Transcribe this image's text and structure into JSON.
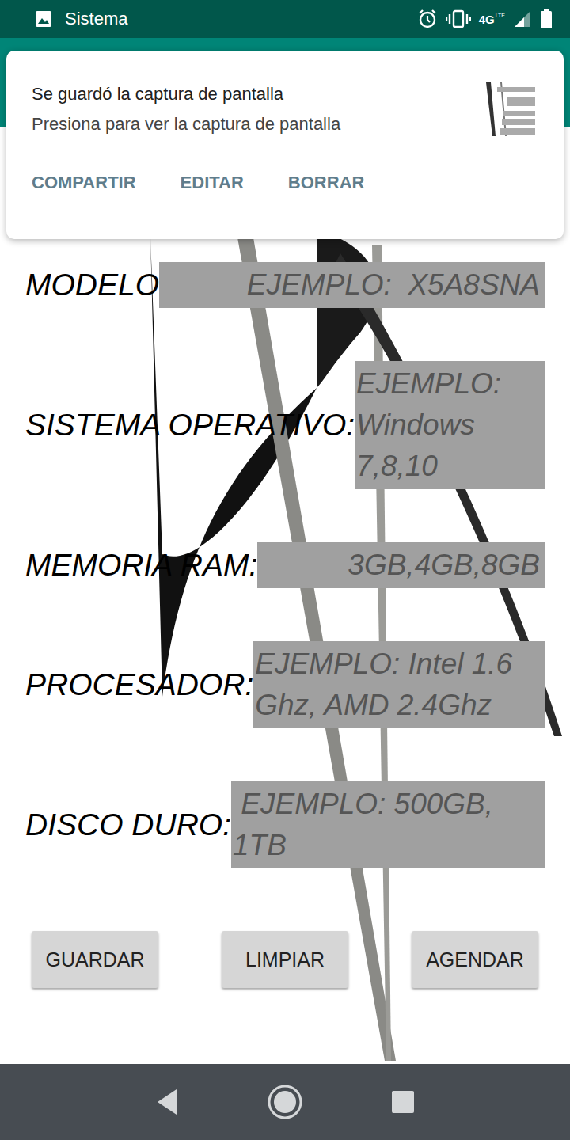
{
  "status_bar": {
    "title": "Sistema",
    "network": "4G",
    "network_badge": "LTE"
  },
  "notification": {
    "title": "Se guardó la captura de pantalla",
    "text": "Presiona para ver la captura de pantalla",
    "actions": [
      "COMPARTIR",
      "EDITAR",
      "BORRAR"
    ]
  },
  "form": {
    "fields": [
      {
        "label": "MODELO",
        "placeholder": "EJEMPLO:  X5A8SNA"
      },
      {
        "label": "SISTEMA OPERATIVO:",
        "placeholder": "EJEMPLO: Windows 7,8,10"
      },
      {
        "label": "MEMORIA RAM:",
        "placeholder": "3GB,4GB,8GB"
      },
      {
        "label": "PROCESADOR:",
        "placeholder": "EJEMPLO: Intel 1.6 Ghz, AMD 2.4Ghz"
      },
      {
        "label": "DISCO DURO:",
        "placeholder": " EJEMPLO: 500GB, 1TB"
      }
    ]
  },
  "buttons": [
    "GUARDAR",
    "LIMPIAR",
    "AGENDAR"
  ]
}
